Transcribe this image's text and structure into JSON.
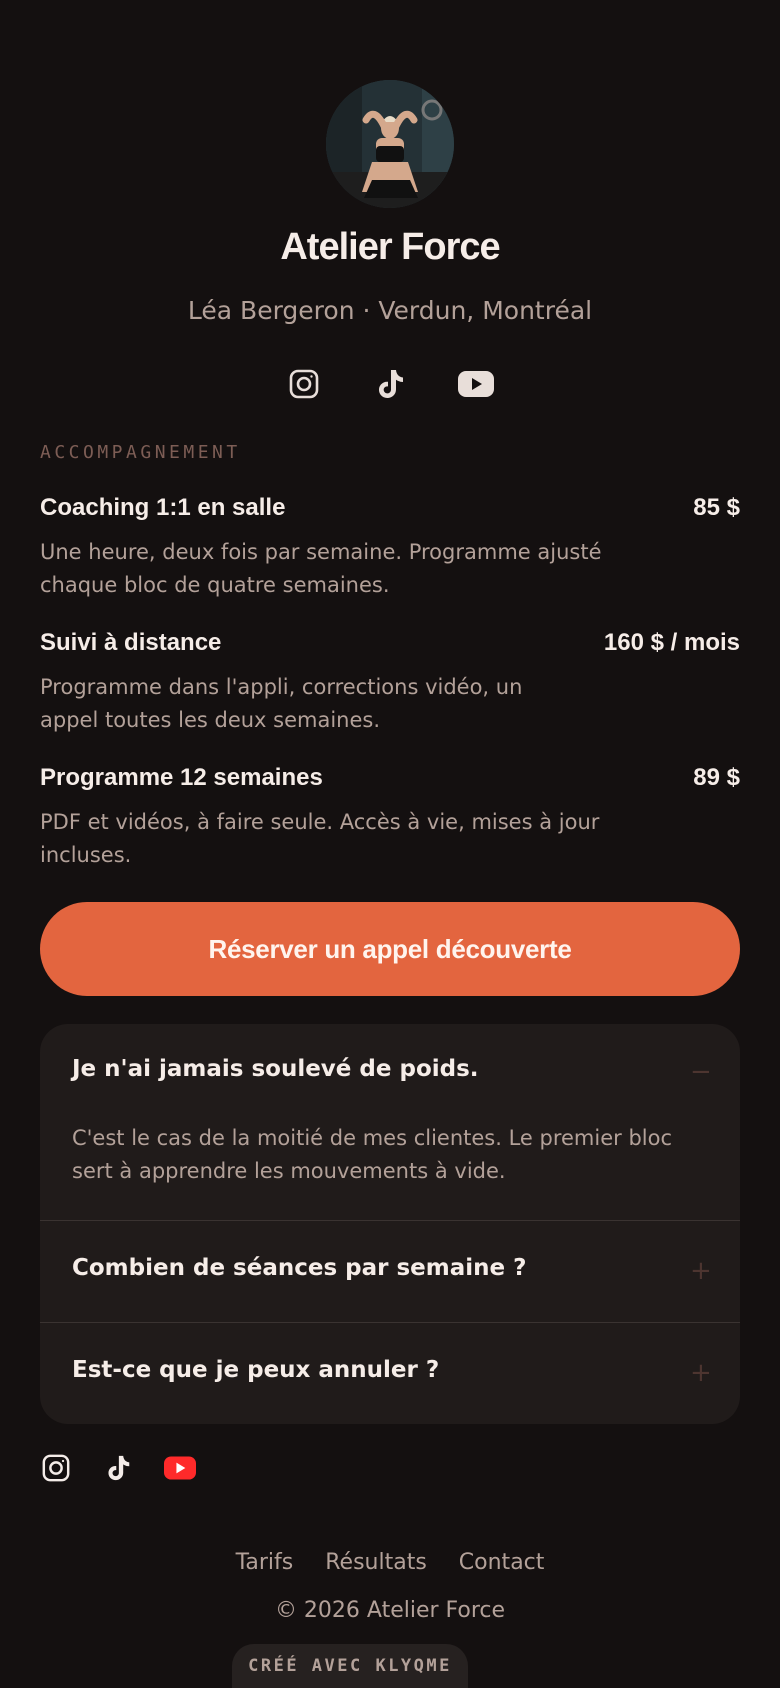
{
  "header": {
    "brand": "Atelier Force",
    "subtitle": "Léa Bergeron · Verdun, Montréal"
  },
  "socials_top": [
    {
      "icon": "instagram-icon"
    },
    {
      "icon": "tiktok-icon"
    },
    {
      "icon": "youtube-icon"
    }
  ],
  "offers": {
    "eyebrow": "ACCOMPAGNEMENT",
    "items": [
      {
        "title": "Coaching 1:1 en salle",
        "price": "85 $",
        "desc": "Une heure, deux fois par semaine. Programme ajusté chaque bloc de quatre semaines."
      },
      {
        "title": "Suivi à distance",
        "price": "160 $ / mois",
        "desc": "Programme dans l'appli, corrections vidéo, un appel toutes les deux semaines."
      },
      {
        "title": "Programme 12 semaines",
        "price": "89 $",
        "desc": "PDF et vidéos, à faire seule. Accès à vie, mises à jour incluses."
      }
    ]
  },
  "cta": {
    "label": "Réserver un appel découverte"
  },
  "faq": {
    "items": [
      {
        "question": "Je n'ai jamais soulevé de poids.",
        "answer": "C'est le cas de la moitié de mes clientes. Le premier bloc sert à apprendre les mouvements à vide.",
        "toggle": "−"
      },
      {
        "question": "Combien de séances par semaine ?",
        "toggle": "+"
      },
      {
        "question": "Est-ce que je peux annuler ?",
        "toggle": "+"
      }
    ]
  },
  "footer": {
    "nav": [
      "Tarifs",
      "Résultats",
      "Contact"
    ],
    "copyright": "© 2026 Atelier Force",
    "badge": "CRÉÉ AVEC KLYQME"
  },
  "colors": {
    "background": "#141010",
    "accent": "#e3653f",
    "youtube_red": "#ff2a2a"
  }
}
